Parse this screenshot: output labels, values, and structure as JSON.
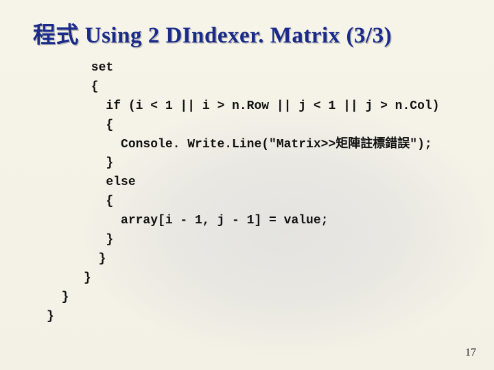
{
  "title": "程式 Using 2 DIndexer. Matrix (3/3)",
  "code": "      set\n      {\n        if (i < 1 || i > n.Row || j < 1 || j > n.Col)\n        {\n          Console. Write.Line(\"Matrix>>矩陣註標錯誤\");\n        }\n        else\n        {\n          array[i - 1, j - 1] = value;\n        }\n       }\n     }\n  }\n}",
  "page_number": "17"
}
